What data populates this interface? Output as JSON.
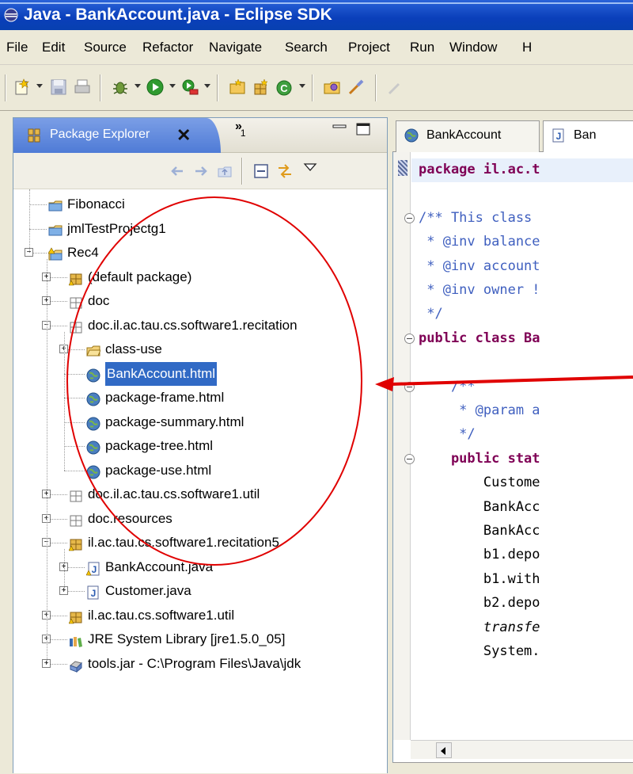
{
  "window": {
    "title": "Java - BankAccount.java - Eclipse SDK"
  },
  "menu": [
    "File",
    "Edit",
    "Source",
    "Refactor",
    "Navigate",
    "Search",
    "Project",
    "Run",
    "Window",
    "H"
  ],
  "toolbar": {
    "icons": [
      "new-wizard-icon",
      "save-icon",
      "print-icon",
      "debug-icon",
      "run-icon",
      "external-tools-icon",
      "new-java-project-icon",
      "new-package-icon",
      "new-class-icon",
      "open-type-icon",
      "search-icon"
    ]
  },
  "package_explorer": {
    "tab_label": "Package Explorer",
    "close_glyph": "✕",
    "more_views": "»",
    "more_views_count": "1",
    "tree": [
      {
        "label": "Fibonacci",
        "icon": "project-folder-icon",
        "depth": 0,
        "expander": ""
      },
      {
        "label": "jmlTestProjectg1",
        "icon": "project-folder-icon",
        "depth": 0,
        "expander": ""
      },
      {
        "label": "Rec4",
        "icon": "project-warning-icon",
        "depth": 0,
        "expander": "−"
      },
      {
        "label": "(default package)",
        "icon": "package-warning-icon",
        "depth": 1,
        "expander": "+"
      },
      {
        "label": "doc",
        "icon": "empty-package-icon",
        "depth": 1,
        "expander": "+"
      },
      {
        "label": "doc.il.ac.tau.cs.software1.recitation",
        "icon": "empty-package-icon",
        "depth": 1,
        "expander": "−"
      },
      {
        "label": "class-use",
        "icon": "folder-icon",
        "depth": 2,
        "expander": "+"
      },
      {
        "label": "BankAccount.html",
        "icon": "html-file-icon",
        "depth": 2,
        "expander": "",
        "selected": true
      },
      {
        "label": "package-frame.html",
        "icon": "html-file-icon",
        "depth": 2,
        "expander": ""
      },
      {
        "label": "package-summary.html",
        "icon": "html-file-icon",
        "depth": 2,
        "expander": ""
      },
      {
        "label": "package-tree.html",
        "icon": "html-file-icon",
        "depth": 2,
        "expander": ""
      },
      {
        "label": "package-use.html",
        "icon": "html-file-icon",
        "depth": 2,
        "expander": ""
      },
      {
        "label": "doc.il.ac.tau.cs.software1.util",
        "icon": "empty-package-icon",
        "depth": 1,
        "expander": "+"
      },
      {
        "label": "doc.resources",
        "icon": "empty-package-icon",
        "depth": 1,
        "expander": "+"
      },
      {
        "label": "il.ac.tau.cs.software1.recitation5",
        "icon": "package-warning-icon",
        "depth": 1,
        "expander": "−"
      },
      {
        "label": "BankAccount.java",
        "icon": "java-file-warning-icon",
        "depth": 2,
        "expander": "+"
      },
      {
        "label": "Customer.java",
        "icon": "java-file-icon",
        "depth": 2,
        "expander": "+"
      },
      {
        "label": "il.ac.tau.cs.software1.util",
        "icon": "package-warning-icon",
        "depth": 1,
        "expander": "+"
      },
      {
        "label": "JRE System Library [jre1.5.0_05]",
        "icon": "library-icon",
        "depth": 1,
        "expander": "+"
      },
      {
        "label": "tools.jar - C:\\Program Files\\Java\\jdk",
        "icon": "jar-icon",
        "depth": 1,
        "expander": "+"
      }
    ]
  },
  "editor": {
    "tabs": [
      {
        "label": "BankAccount",
        "icon": "html-file-icon"
      },
      {
        "label": "Ban",
        "icon": "java-file-icon"
      }
    ],
    "lines": [
      {
        "text": "package il.ac.t",
        "kind": "pkg"
      },
      {
        "text": "",
        "kind": "blank"
      },
      {
        "text": "/** This class",
        "kind": "comment",
        "fold": true
      },
      {
        "text": " * @inv balance",
        "kind": "tagline"
      },
      {
        "text": " * @inv account",
        "kind": "tagline"
      },
      {
        "text": " * @inv owner !",
        "kind": "tagline"
      },
      {
        "text": " */",
        "kind": "comment"
      },
      {
        "text": "public class Ba",
        "kind": "classdecl",
        "fold": true
      },
      {
        "text": "",
        "kind": "blank"
      },
      {
        "text": "    /**",
        "kind": "comment",
        "fold": true
      },
      {
        "text": "     * @param a",
        "kind": "tagline"
      },
      {
        "text": "     */",
        "kind": "comment"
      },
      {
        "text": "    public stat",
        "kind": "method",
        "fold": true
      },
      {
        "text": "        Custome",
        "kind": "code"
      },
      {
        "text": "        BankAcc",
        "kind": "code"
      },
      {
        "text": "        BankAcc",
        "kind": "code"
      },
      {
        "text": "        b1.depo",
        "kind": "code"
      },
      {
        "text": "        b1.with",
        "kind": "code"
      },
      {
        "text": "        b2.depo",
        "kind": "code"
      },
      {
        "text": "        transfe",
        "kind": "italic"
      },
      {
        "text": "        System.",
        "kind": "code"
      }
    ]
  },
  "colors": {
    "title_bar": "#0a3fba",
    "selection": "#316ac5",
    "annotation": "#e00000",
    "keyword": "#7f0055",
    "javadoc": "#3f5fbf"
  }
}
